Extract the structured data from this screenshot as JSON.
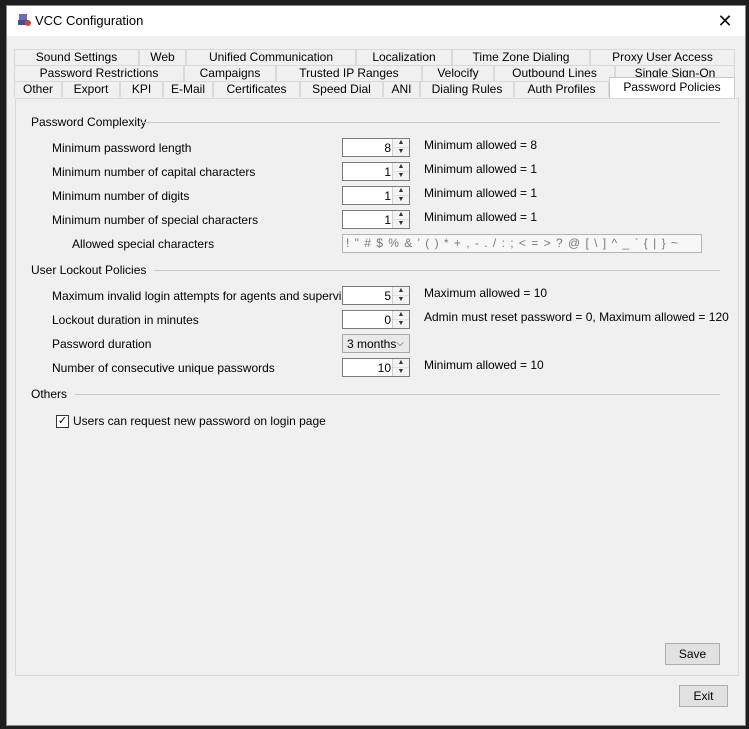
{
  "window": {
    "title": "VCC Configuration",
    "close_glyph": "✕",
    "icon": "app-icon"
  },
  "tabs": {
    "row1": [
      "Sound Settings",
      "Web",
      "Unified Communication",
      "Localization",
      "Time Zone Dialing",
      "Proxy User Access"
    ],
    "row2": [
      "Password Restrictions",
      "Campaigns",
      "Trusted IP Ranges",
      "Velocify",
      "Outbound Lines",
      "Single Sign-On"
    ],
    "row3": [
      "Other",
      "Export",
      "KPI",
      "E-Mail",
      "Certificates",
      "Speed Dial",
      "ANI",
      "Dialing Rules",
      "Auth Profiles",
      "Password Policies"
    ],
    "active": "Password Policies"
  },
  "password_complexity": {
    "title": "Password Complexity",
    "fields": [
      {
        "label": "Minimum password length",
        "value": "8",
        "hint": "Minimum allowed = 8"
      },
      {
        "label": "Minimum number of capital characters",
        "value": "1",
        "hint": "Minimum allowed = 1"
      },
      {
        "label": "Minimum number of digits",
        "value": "1",
        "hint": "Minimum allowed = 1"
      },
      {
        "label": "Minimum number of special characters",
        "value": "1",
        "hint": "Minimum allowed = 1"
      }
    ],
    "special_label": "Allowed special characters",
    "special_value": "! \" # $ % & ' ( ) * + , - . / : ; < = > ? @ [ \\ ] ^ _ ` { | } ~"
  },
  "user_lockout": {
    "title": "User Lockout Policies",
    "max_attempts": {
      "label": "Maximum invalid login attempts for agents and supervisors",
      "value": "5",
      "hint": "Maximum allowed = 10"
    },
    "lockout_duration": {
      "label": "Lockout duration in minutes",
      "value": "0",
      "hint": "Admin must reset password = 0, Maximum allowed = 120"
    },
    "password_duration": {
      "label": "Password duration",
      "value": "3 months"
    },
    "unique_passwords": {
      "label": "Number of consecutive unique passwords",
      "value": "10",
      "hint": "Minimum allowed = 10"
    }
  },
  "others": {
    "title": "Others",
    "checkbox_label": "Users can request new password on login page",
    "checked": true
  },
  "buttons": {
    "save": "Save",
    "exit": "Exit"
  }
}
